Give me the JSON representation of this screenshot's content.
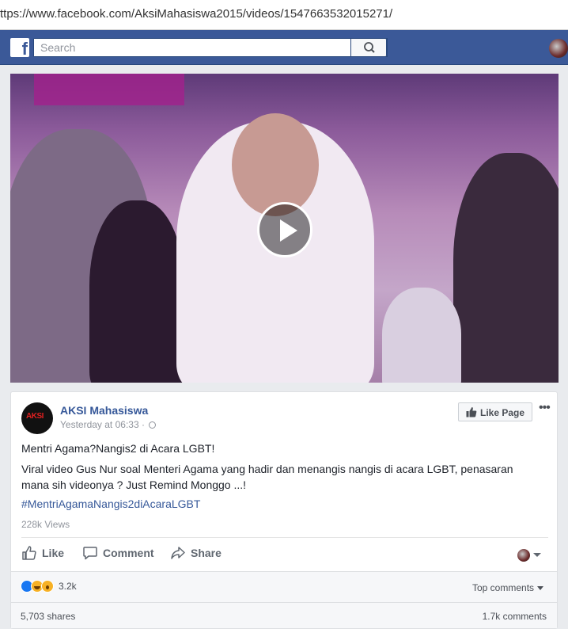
{
  "browser": {
    "url": "ttps://www.facebook.com/AksiMahasiswa2015/videos/1547663532015271/"
  },
  "header": {
    "logo": "f",
    "search_placeholder": "Search",
    "search_icon": "search-icon",
    "brand_color": "#3b5998"
  },
  "video": {
    "play_icon": "play-icon"
  },
  "post": {
    "page_name": "AKSI Mahasiswa",
    "avatar_text": "AKSI",
    "timestamp": "Yesterday at 06:33",
    "separator": " · ",
    "like_page_label": "Like Page",
    "more_label": "•••",
    "title": "Mentri Agama?Nangis2 di Acara LGBT!",
    "body": "Viral video Gus Nur soal Menteri Agama yang hadir dan menangis nangis di acara LGBT, penasaran mana sih videonya ? Just Remind Monggo ...!",
    "hashtag": "#MentriAgamaNangis2diAcaraLGBT",
    "views": "228k Views"
  },
  "actions": {
    "like": "Like",
    "comment": "Comment",
    "share": "Share"
  },
  "footer": {
    "reactions_count": "3.2k",
    "reaction_icons": [
      "like-icon",
      "haha-icon",
      "wow-icon"
    ],
    "top_comments": "Top comments",
    "shares": "5,703 shares",
    "comments": "1.7k comments",
    "link_color": "#365899"
  }
}
